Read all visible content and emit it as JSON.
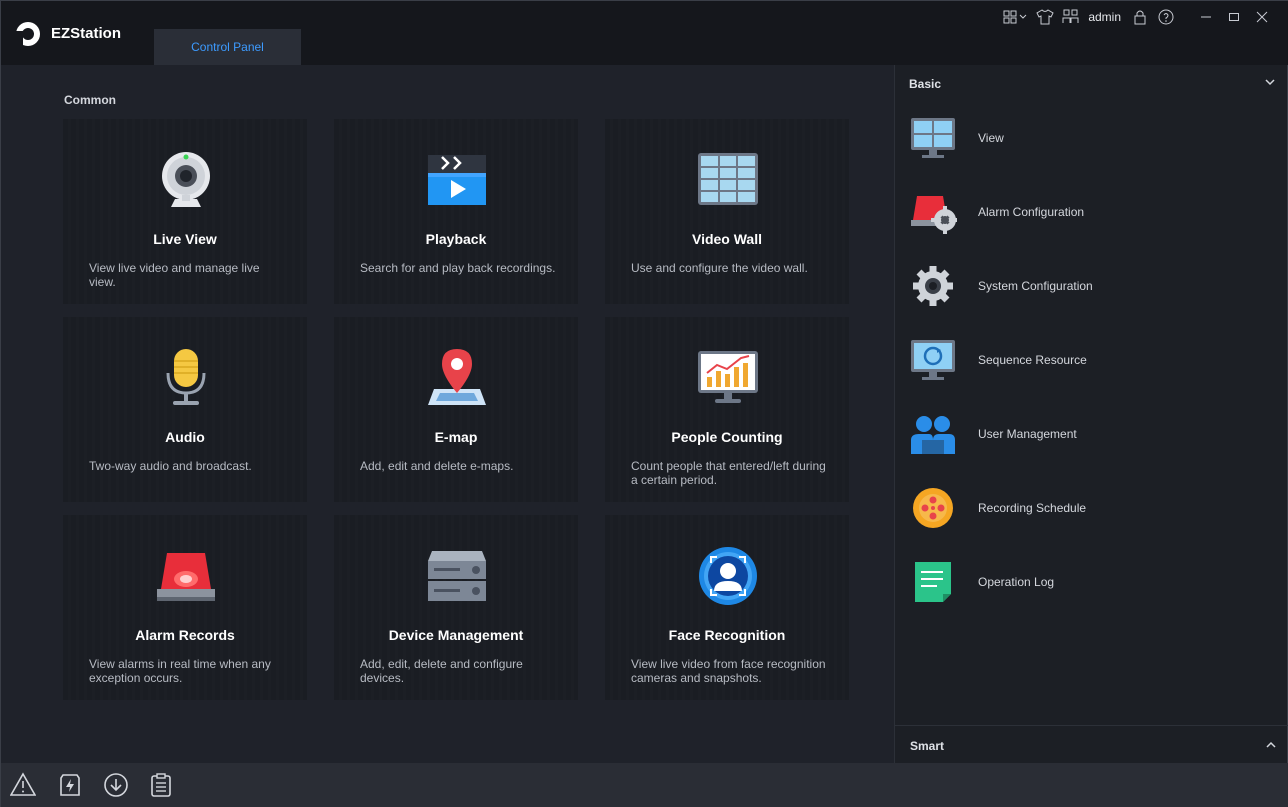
{
  "app": {
    "name": "EZStation",
    "tab": "Control Panel",
    "user": "admin"
  },
  "main": {
    "section": "Common",
    "cards": [
      {
        "title": "Live View",
        "desc": "View live video and manage live view.",
        "icon": "webcam-icon"
      },
      {
        "title": "Playback",
        "desc": "Search for and play back recordings.",
        "icon": "playback-icon"
      },
      {
        "title": "Video Wall",
        "desc": "Use and configure the video wall.",
        "icon": "video-wall-icon"
      },
      {
        "title": "Audio",
        "desc": "Two-way audio and broadcast.",
        "icon": "microphone-icon"
      },
      {
        "title": "E-map",
        "desc": "Add, edit and delete e-maps.",
        "icon": "map-pin-icon"
      },
      {
        "title": "People Counting",
        "desc": "Count people that entered/left during a certain period.",
        "icon": "chart-monitor-icon"
      },
      {
        "title": "Alarm Records",
        "desc": "View alarms in real time when any exception occurs.",
        "icon": "alarm-light-icon"
      },
      {
        "title": "Device Management",
        "desc": "Add, edit, delete and configure devices.",
        "icon": "server-icon"
      },
      {
        "title": "Face Recognition",
        "desc": "View live video from face recognition cameras and snapshots.",
        "icon": "face-icon"
      }
    ]
  },
  "side": {
    "basic": "Basic",
    "smart": "Smart",
    "items": [
      {
        "label": "View",
        "icon": "view-monitor-icon"
      },
      {
        "label": "Alarm Configuration",
        "icon": "alarm-config-icon"
      },
      {
        "label": "System Configuration",
        "icon": "gear-icon"
      },
      {
        "label": "Sequence Resource",
        "icon": "sequence-monitor-icon"
      },
      {
        "label": "User Management",
        "icon": "users-icon"
      },
      {
        "label": "Recording Schedule",
        "icon": "film-reel-icon"
      },
      {
        "label": "Operation Log",
        "icon": "log-icon"
      }
    ]
  },
  "colors": {
    "accent": "#3d9bff",
    "background": "#1f222a",
    "titlebar": "#15171c"
  }
}
